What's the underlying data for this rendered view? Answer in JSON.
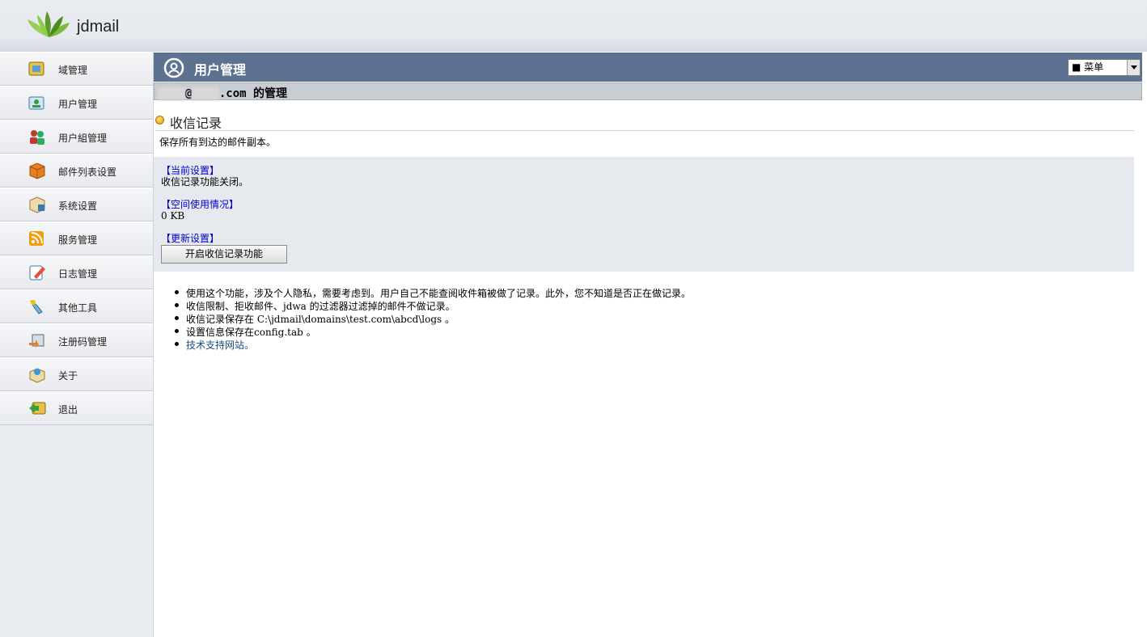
{
  "app": {
    "logo_text": "jdmail"
  },
  "sidebar": {
    "items": [
      {
        "label": "域管理",
        "icon": "domain-icon"
      },
      {
        "label": "用户管理",
        "icon": "user-icon"
      },
      {
        "label": "用户組管理",
        "icon": "user-group-icon"
      },
      {
        "label": "邮件列表设置",
        "icon": "mailing-list-icon"
      },
      {
        "label": "系统设置",
        "icon": "system-settings-icon"
      },
      {
        "label": "服务管理",
        "icon": "service-icon"
      },
      {
        "label": "日志管理",
        "icon": "log-icon"
      },
      {
        "label": "其他工具",
        "icon": "tools-icon"
      },
      {
        "label": "注册码管理",
        "icon": "registration-icon"
      },
      {
        "label": "关于",
        "icon": "about-icon"
      },
      {
        "label": "退出",
        "icon": "logout-icon"
      }
    ]
  },
  "titlebar": {
    "title": "用户管理",
    "menu_value": "■ 菜单"
  },
  "subheader": {
    "blurred_user": "abcd",
    "blurred_domain": "test",
    "text": ".com 的管理"
  },
  "section": {
    "title": "收信记录",
    "description": "保存所有到达的邮件副本。"
  },
  "settings": {
    "current_head": "【当前设置】",
    "current_value": "收信记录功能关闭。",
    "usage_head": "【空间使用情况】",
    "usage_value": "0 KB",
    "update_head": "【更新设置】",
    "enable_button": "开启收信记录功能"
  },
  "notes": [
    "使用这个功能，涉及个人隐私，需要考虑到。用户自己不能查阅收件箱被做了记录。此外，您不知道是否正在做记录。",
    "收信限制、拒收邮件、jdwa 的过滤器过滤掉的邮件不做记录。",
    "收信记录保存在  C:\\jdmail\\domains\\test.com\\abcd\\logs 。",
    "设置信息保存在config.tab 。"
  ],
  "support_link": "技术支持网站。",
  "colors": {
    "titlebar": "#5c7290",
    "link": "#0000cc"
  }
}
